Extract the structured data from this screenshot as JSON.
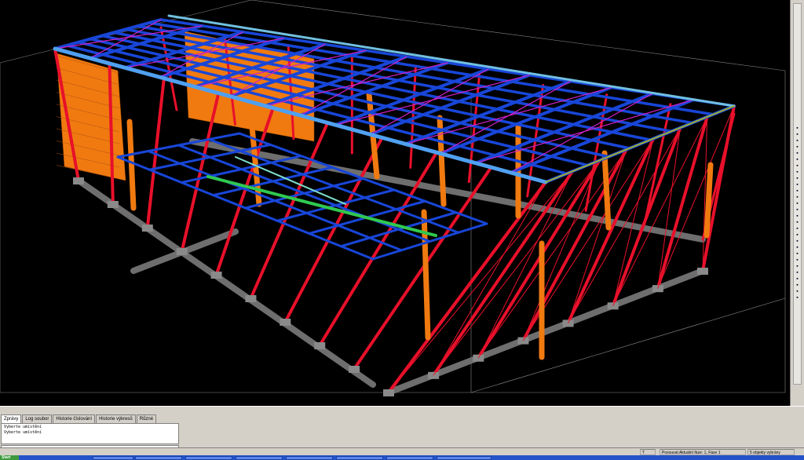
{
  "command_panel": {
    "tabs": [
      {
        "label": "Zprávy",
        "active": true
      },
      {
        "label": "Log soubor",
        "active": false
      },
      {
        "label": "Historie číslování",
        "active": false
      },
      {
        "label": "Historie výkresů",
        "active": false
      },
      {
        "label": "Různé",
        "active": false
      }
    ],
    "lines": [
      "Vyberte umístění",
      "Vyberte umístění"
    ]
  },
  "status_bar": {
    "mode": "T",
    "info": "Posouvat Aktuální fáze: 1, Fáze 1",
    "selection": "5 objekty vybrány"
  },
  "taskbar": {
    "start_label": "Start",
    "accent": "#2452c8"
  },
  "colors": {
    "column": "#e8102a",
    "beam": "#1846d8",
    "bracing": "#d020c8",
    "cladding": "#f07a10",
    "foundation": "#6e6e6e",
    "purlin_green": "#30c850"
  }
}
